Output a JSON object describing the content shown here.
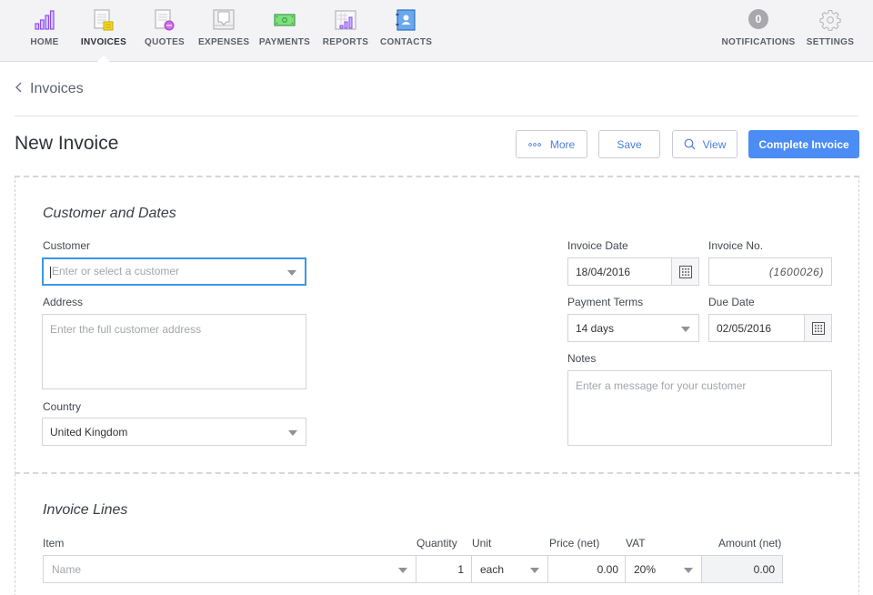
{
  "nav": {
    "items": [
      {
        "label": "HOME",
        "icon": "home-bars-icon"
      },
      {
        "label": "INVOICES",
        "icon": "invoice-icon",
        "active": true
      },
      {
        "label": "QUOTES",
        "icon": "quote-icon"
      },
      {
        "label": "EXPENSES",
        "icon": "expense-icon"
      },
      {
        "label": "PAYMENTS",
        "icon": "payment-icon"
      },
      {
        "label": "REPORTS",
        "icon": "report-icon"
      },
      {
        "label": "CONTACTS",
        "icon": "contact-icon"
      }
    ],
    "notifications": {
      "label": "NOTIFICATIONS",
      "count": "0"
    },
    "settings": {
      "label": "SETTINGS"
    }
  },
  "breadcrumb": {
    "back_label": "Invoices"
  },
  "page": {
    "title": "New Invoice"
  },
  "toolbar": {
    "more_label": "More",
    "save_label": "Save",
    "view_label": "View",
    "complete_label": "Complete Invoice"
  },
  "colors": {
    "primary": "#4b8cf5",
    "focus": "#3a97e6",
    "nav_bg": "#f3f3f5"
  },
  "customer_section": {
    "title": "Customer and Dates",
    "customer": {
      "label": "Customer",
      "value": "",
      "placeholder": "Enter or select a customer"
    },
    "address": {
      "label": "Address",
      "value": "",
      "placeholder": "Enter the full customer address"
    },
    "country": {
      "label": "Country",
      "value": "United Kingdom"
    },
    "invoice_date": {
      "label": "Invoice Date",
      "value": "18/04/2016"
    },
    "invoice_no": {
      "label": "Invoice No.",
      "value": "(1600026)"
    },
    "payment_terms": {
      "label": "Payment Terms",
      "value": "14 days"
    },
    "due_date": {
      "label": "Due Date",
      "value": "02/05/2016"
    },
    "notes": {
      "label": "Notes",
      "value": "",
      "placeholder": "Enter a message for your customer"
    }
  },
  "lines_section": {
    "title": "Invoice Lines",
    "columns": [
      "Item",
      "Quantity",
      "Unit",
      "Price (net)",
      "VAT",
      "Amount (net)"
    ],
    "rows": [
      {
        "item": "",
        "item_placeholder": "Name",
        "quantity": "1",
        "unit": "each",
        "price": "0.00",
        "vat": "20%",
        "amount": "0.00"
      }
    ]
  }
}
